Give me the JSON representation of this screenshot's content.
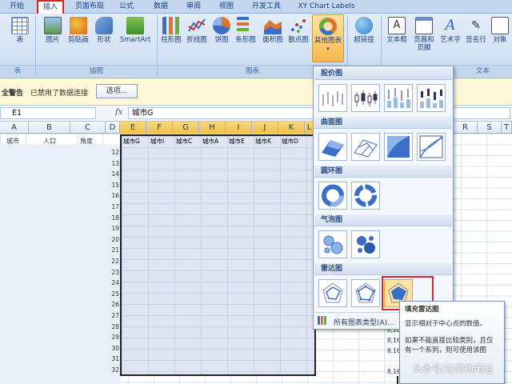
{
  "tabs": [
    "开始",
    "插入",
    "页面布局",
    "公式",
    "数据",
    "审阅",
    "视图",
    "开发工具",
    "XY Chart Labels"
  ],
  "ribbon": {
    "buttons": [
      "表",
      "图片",
      "剪贴画",
      "形状",
      "SmartArt",
      "柱形图",
      "折线图",
      "饼图",
      "条形图",
      "面积图",
      "散点图",
      "其他图表",
      "超链接",
      "文本框",
      "页眉和页脚",
      "艺术字",
      "签名行",
      "对象"
    ],
    "groups": [
      "表",
      "插图",
      "图表",
      "文本"
    ]
  },
  "msgbar": {
    "warning": "全警告",
    "text": "已禁用了数据连接",
    "button": "选项..."
  },
  "formula": {
    "namebox": "E1",
    "fx": "fx",
    "value": "城市G"
  },
  "columns": [
    "A",
    "B",
    "C",
    "D",
    "E",
    "F",
    "G",
    "H",
    "I",
    "J",
    "K",
    "L",
    "R",
    "S",
    "T"
  ],
  "leftheaders": [
    "城市",
    "人口",
    "角度"
  ],
  "rownums": [
    "12",
    "13",
    "14",
    "15",
    "16",
    "17",
    "18",
    "19",
    "20",
    "21",
    "22",
    "23",
    "24",
    "25",
    "26",
    "27",
    "28",
    "29",
    "30",
    "31",
    "32"
  ],
  "cityheaders": [
    "城市G",
    "城市I",
    "城市C",
    "城市A",
    "城市E",
    "城市K",
    "城市D"
  ],
  "rightvals": [
    "8,16",
    "8,16",
    "8,16",
    "8,16"
  ],
  "dropdown": {
    "sections": [
      "股价图",
      "曲面图",
      "圆环图",
      "气泡图",
      "雷达图"
    ],
    "alltypes": "所有图表类型(A)..."
  },
  "tooltip": {
    "title": "填充雷达图",
    "line1": "显示相对于中心点的数值。",
    "line2": "如果不能直接比较类别，且仅有一个系列，则可使用该图"
  },
  "watermark": "头条号/白清扬闲话"
}
